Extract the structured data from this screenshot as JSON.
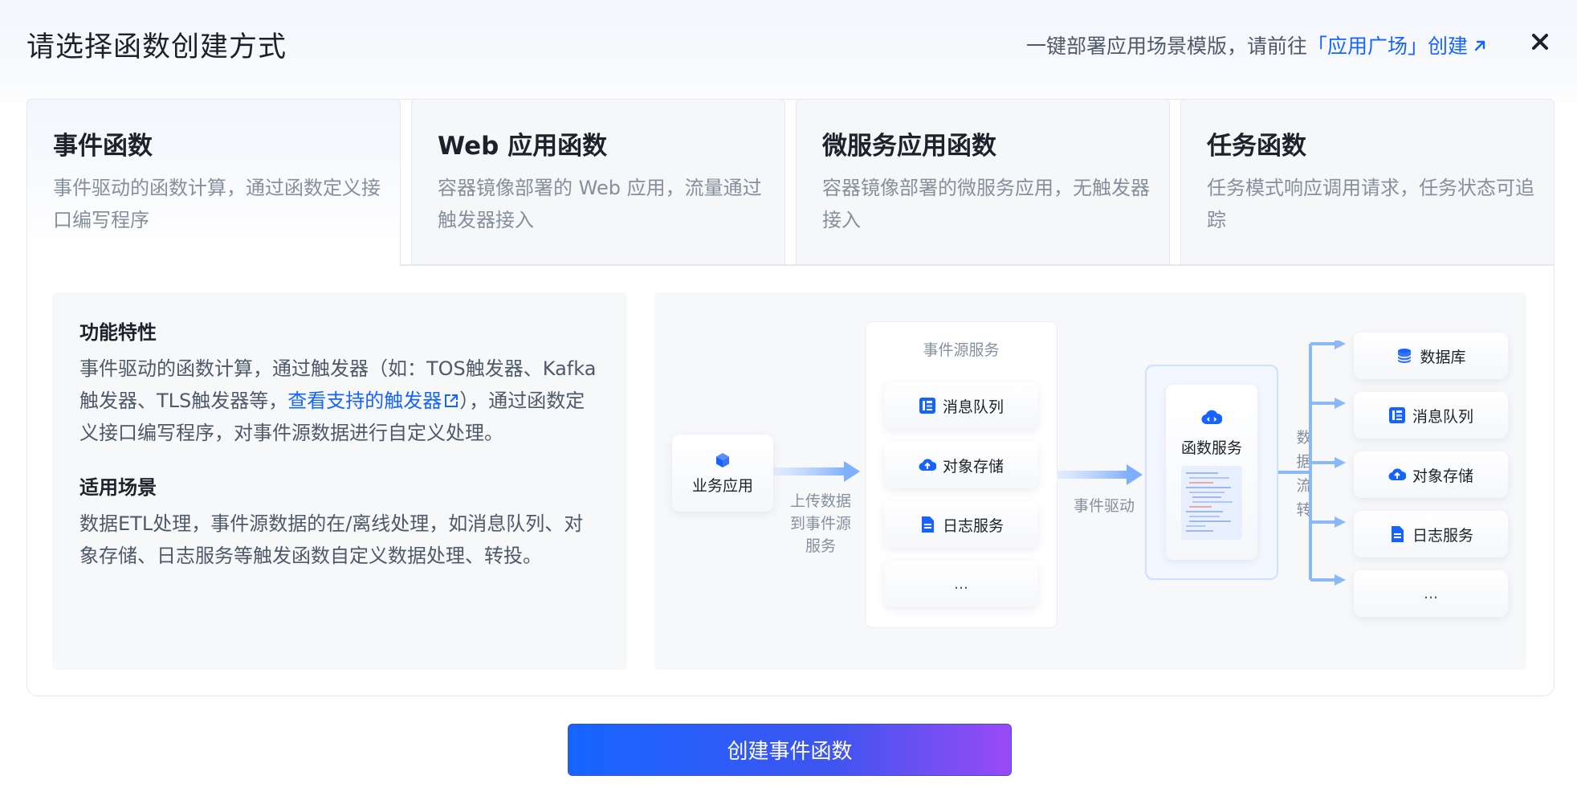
{
  "header": {
    "title": "请选择函数创建方式",
    "hint_prefix": "一键部署应用场景模版，请前往",
    "hint_link": "「应用广场」创建"
  },
  "tabs": [
    {
      "title": "事件函数",
      "desc": "事件驱动的函数计算，通过函数定义接口编写程序"
    },
    {
      "title": "Web 应用函数",
      "desc": "容器镜像部署的 Web 应用，流量通过触发器接入"
    },
    {
      "title": "微服务应用函数",
      "desc": "容器镜像部署的微服务应用，无触发器接入"
    },
    {
      "title": "任务函数",
      "desc": "任务模式响应调用请求，任务状态可追踪"
    }
  ],
  "features": {
    "title": "功能特性",
    "text_before_link": "事件驱动的函数计算，通过触发器（如：TOS触发器、Kafka触发器、TLS触发器等，",
    "link": "查看支持的触发器",
    "text_after_link": "），通过函数定义接口编写程序，对事件源数据进行自定义处理。"
  },
  "scenarios": {
    "title": "适用场景",
    "text": "数据ETL处理，事件源数据的在/离线处理，如消息队列、对象存储、日志服务等触发函数自定义数据处理、转投。"
  },
  "diagram": {
    "app": "业务应用",
    "upload_label_lines": [
      "上传数据",
      "到事件源",
      "服务"
    ],
    "source_group_title": "事件源服务",
    "sources": [
      "消息队列",
      "对象存储",
      "日志服务",
      "..."
    ],
    "drive_label": "事件驱动",
    "function_service": "函数服务",
    "flow_label_chars": [
      "数",
      "据",
      "流",
      "转"
    ],
    "targets": [
      "数据库",
      "消息队列",
      "对象存储",
      "日志服务",
      "..."
    ]
  },
  "create_button": "创建事件函数",
  "colors": {
    "accent": "#1664ff",
    "button_gradient_end": "#9a4af5"
  }
}
